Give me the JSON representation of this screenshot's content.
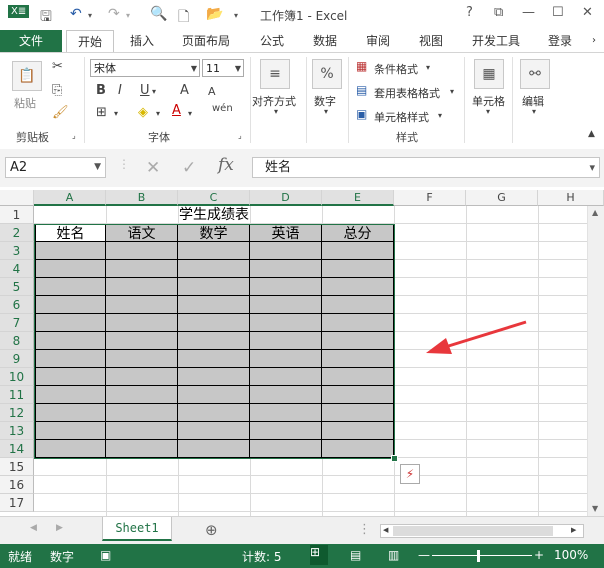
{
  "window": {
    "title": "工作簿1 - Excel",
    "help": "?",
    "restore": "⧉",
    "minimize": "—",
    "maximize": "☐",
    "close": "✕"
  },
  "ribbon_tabs": [
    "文件",
    "开始",
    "插入",
    "页面布局",
    "公式",
    "数据",
    "审阅",
    "视图",
    "开发工具"
  ],
  "account": "登录",
  "ribbon": {
    "clipboard": {
      "paste": "粘贴",
      "label": "剪贴板"
    },
    "font": {
      "name": "宋体",
      "size": "11",
      "label": "字体",
      "bold": "B",
      "italic": "I",
      "underline": "U",
      "grow": "A",
      "shrink": "A",
      "phonetic": "wén"
    },
    "alignment": {
      "label": "对齐方式"
    },
    "number": {
      "label": "数字",
      "symbol": "%"
    },
    "styles": {
      "conditional": "条件格式",
      "table": "套用表格格式",
      "cell": "单元格样式",
      "label": "样式"
    },
    "cells": {
      "label": "单元格"
    },
    "editing": {
      "label": "编辑"
    }
  },
  "formula_bar": {
    "name_box": "A2",
    "content": "姓名",
    "fx": "fx"
  },
  "columns": [
    "A",
    "B",
    "C",
    "D",
    "E",
    "F",
    "G",
    "H"
  ],
  "rows": [
    "1",
    "2",
    "3",
    "4",
    "5",
    "6",
    "7",
    "8",
    "9",
    "10",
    "11",
    "12",
    "13",
    "14",
    "15",
    "16",
    "17"
  ],
  "sheet": {
    "title": "学生成绩表",
    "headers": [
      "姓名",
      "语文",
      "数学",
      "英语",
      "总分"
    ]
  },
  "sheet_tabs": [
    "Sheet1"
  ],
  "status": {
    "mode": "就绪",
    "num": "数字",
    "count": "计数: 5",
    "zoom": "100%"
  },
  "colors": {
    "accent": "#217346",
    "cell_fill": "#c7c7c7",
    "arrow": "#e8373c"
  }
}
